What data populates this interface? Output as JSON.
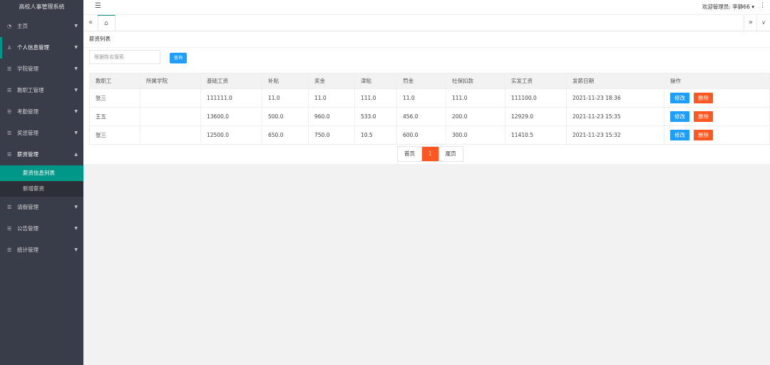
{
  "app": {
    "title": "高校人事管理系统"
  },
  "header": {
    "user": "欢迎管理员: 李静66 ▾"
  },
  "sidebar": {
    "items": [
      {
        "label": "主页",
        "icon": "dashboard-icon"
      },
      {
        "label": "个人信息管理",
        "icon": "user-icon"
      },
      {
        "label": "学院管理",
        "icon": "list-icon"
      },
      {
        "label": "教职工管理",
        "icon": "list-icon"
      },
      {
        "label": "考勤管理",
        "icon": "list-icon"
      },
      {
        "label": "奖惩管理",
        "icon": "list-icon"
      },
      {
        "label": "薪资管理",
        "icon": "list-icon"
      },
      {
        "label": "请假管理",
        "icon": "list-icon"
      },
      {
        "label": "公告管理",
        "icon": "list-icon"
      },
      {
        "label": "统计管理",
        "icon": "list-icon"
      }
    ],
    "sub_items": [
      {
        "label": "薪资信息列表"
      },
      {
        "label": "新增薪资"
      }
    ]
  },
  "page": {
    "title": "薪资列表",
    "search_placeholder": "根据姓名搜索",
    "search_button": "查询"
  },
  "table": {
    "headers": [
      "教职工",
      "所属学院",
      "基础工资",
      "补贴",
      "奖金",
      "津贴",
      "罚金",
      "社保扣款",
      "实发工资",
      "发薪日期",
      "操作"
    ],
    "rows": [
      [
        "张三",
        "",
        "111111.0",
        "11.0",
        "11.0",
        "111.0",
        "11.0",
        "111.0",
        "111100.0",
        "2021-11-23 18:36"
      ],
      [
        "王五",
        "",
        "13600.0",
        "500.0",
        "960.0",
        "533.0",
        "456.0",
        "200.0",
        "12929.0",
        "2021-11-23 15:35"
      ],
      [
        "张三",
        "",
        "12500.0",
        "650.0",
        "750.0",
        "10.5",
        "600.0",
        "300.0",
        "11410.5",
        "2021-11-23 15:32"
      ]
    ],
    "edit_label": "修改",
    "delete_label": "删除"
  },
  "pager": {
    "first": "首页",
    "current": "1",
    "last": "尾页"
  },
  "colors": {
    "accent": "#009688",
    "primary": "#1e9fff",
    "danger": "#ff5722",
    "sidebar": "#393d49"
  }
}
